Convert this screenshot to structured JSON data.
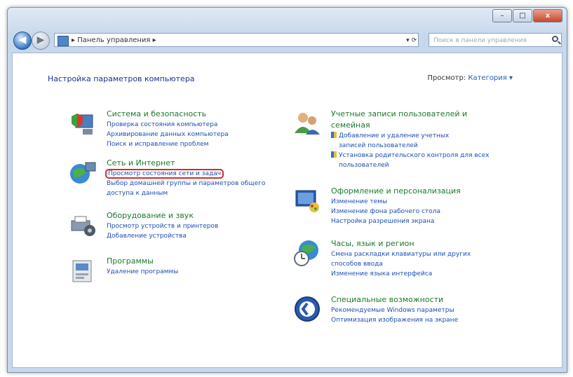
{
  "window": {
    "buttons": {
      "minimize": "–",
      "maximize": "□",
      "close": "x"
    }
  },
  "navbar": {
    "back": "◀",
    "forward": "▶",
    "address": "▸ Панель управления ▸",
    "address_controls": "▾  ⟳",
    "search_placeholder": "Поиск в панели управления"
  },
  "heading": "Настройка параметров компьютера",
  "viewby": {
    "label": "Просмотр:",
    "value": "Категория ▾"
  },
  "categories_left": [
    {
      "title": "Система и безопасность",
      "links": [
        "Проверка состояния компьютера",
        "Архивирование данных компьютера",
        "Поиск и исправление проблем"
      ]
    },
    {
      "title": "Сеть и Интернет",
      "links": [
        "Просмотр состояния сети и задач",
        "Выбор домашней группы и параметров общего",
        "доступа к данным"
      ]
    },
    {
      "title": "Оборудование и звук",
      "links": [
        "Просмотр устройств и принтеров",
        "Добавление устройства"
      ]
    },
    {
      "title": "Программы",
      "links": [
        "Удаление программы"
      ]
    }
  ],
  "categories_right": [
    {
      "title": "Учетные записи пользователей и",
      "title2": "семейная",
      "links": [
        "Добавление и удаление учетных",
        "записей пользователей",
        "Установка родительского контроля для всех",
        "пользователей"
      ]
    },
    {
      "title": "Оформление и персонализация",
      "links": [
        "Изменение темы",
        "Изменение фона рабочего стола",
        "Настройка разрешения экрана"
      ]
    },
    {
      "title": "Часы, язык и регион",
      "links": [
        "Смена раскладки клавиатуры или других",
        "способов ввода",
        "Изменение языка интерфейса"
      ]
    },
    {
      "title": "Специальные возможности",
      "links": [
        "Рекомендуемые Windows параметры",
        "Оптимизация изображения на экране"
      ]
    }
  ],
  "colors": {
    "accent": "#1a4fb4",
    "category_title": "#1a7a2a",
    "highlight": "#d62a2a"
  }
}
